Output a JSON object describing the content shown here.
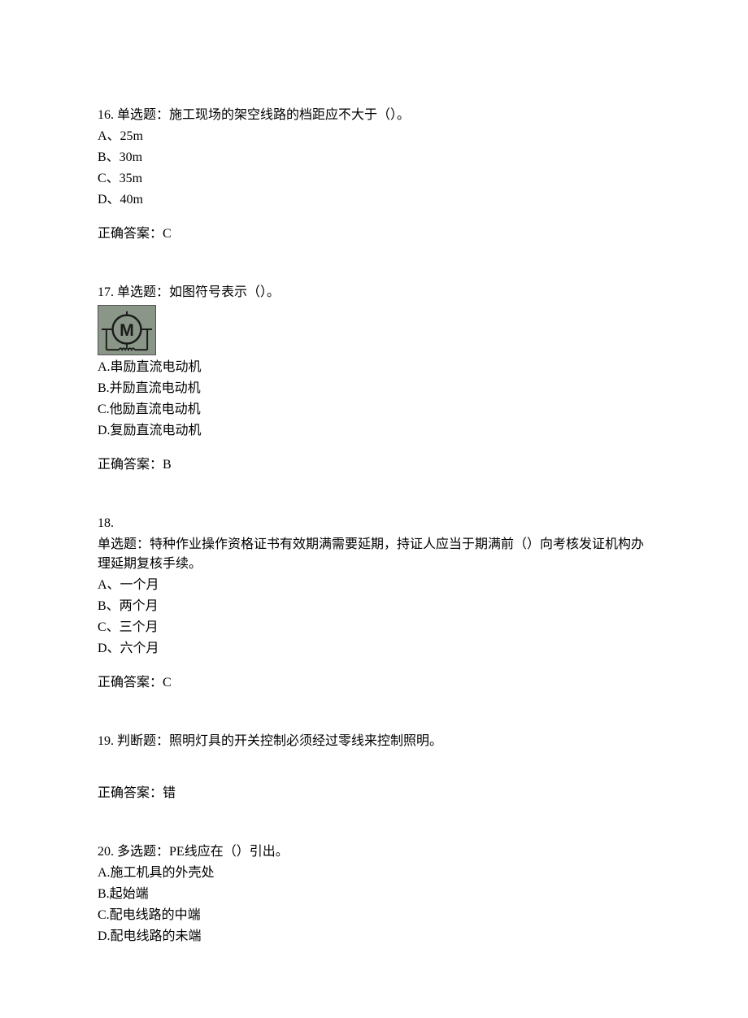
{
  "questions": [
    {
      "num_prefix": "16. ",
      "type_label": "单选题：",
      "stem": "施工现场的架空线路的档距应不大于（）。",
      "options": [
        "A、25m",
        "B、30m",
        "C、35m",
        "D、40m"
      ],
      "answer_label": "正确答案：",
      "answer": "C"
    },
    {
      "num_prefix": "17. ",
      "type_label": "单选题：",
      "stem": "如图符号表示（）。",
      "has_image": true,
      "options": [
        "A.串励直流电动机",
        "B.并励直流电动机",
        "C.他励直流电动机",
        "D.复励直流电动机"
      ],
      "answer_label": "正确答案：",
      "answer": "B"
    },
    {
      "num_prefix": "18.",
      "type_label": "单选题：",
      "stem": "特种作业操作资格证书有效期满需要延期，持证人应当于期满前（）向考核发证机构办理延期复核手续。",
      "stem_on_new_line": true,
      "options": [
        "A、一个月",
        "B、两个月",
        "C、三个月",
        "D、六个月"
      ],
      "answer_label": "正确答案：",
      "answer": "C"
    },
    {
      "num_prefix": "19. ",
      "type_label": "判断题：",
      "stem": "照明灯具的开关控制必须经过零线来控制照明。",
      "options": [],
      "answer_label": "正确答案：",
      "answer": "错",
      "extra_margin": true
    },
    {
      "num_prefix": "20. ",
      "type_label": "多选题：",
      "stem": "PE线应在（）引出。",
      "options": [
        "A.施工机具的外壳处",
        "B.起始端",
        "C.配电线路的中端",
        "D.配电线路的未端"
      ]
    }
  ]
}
